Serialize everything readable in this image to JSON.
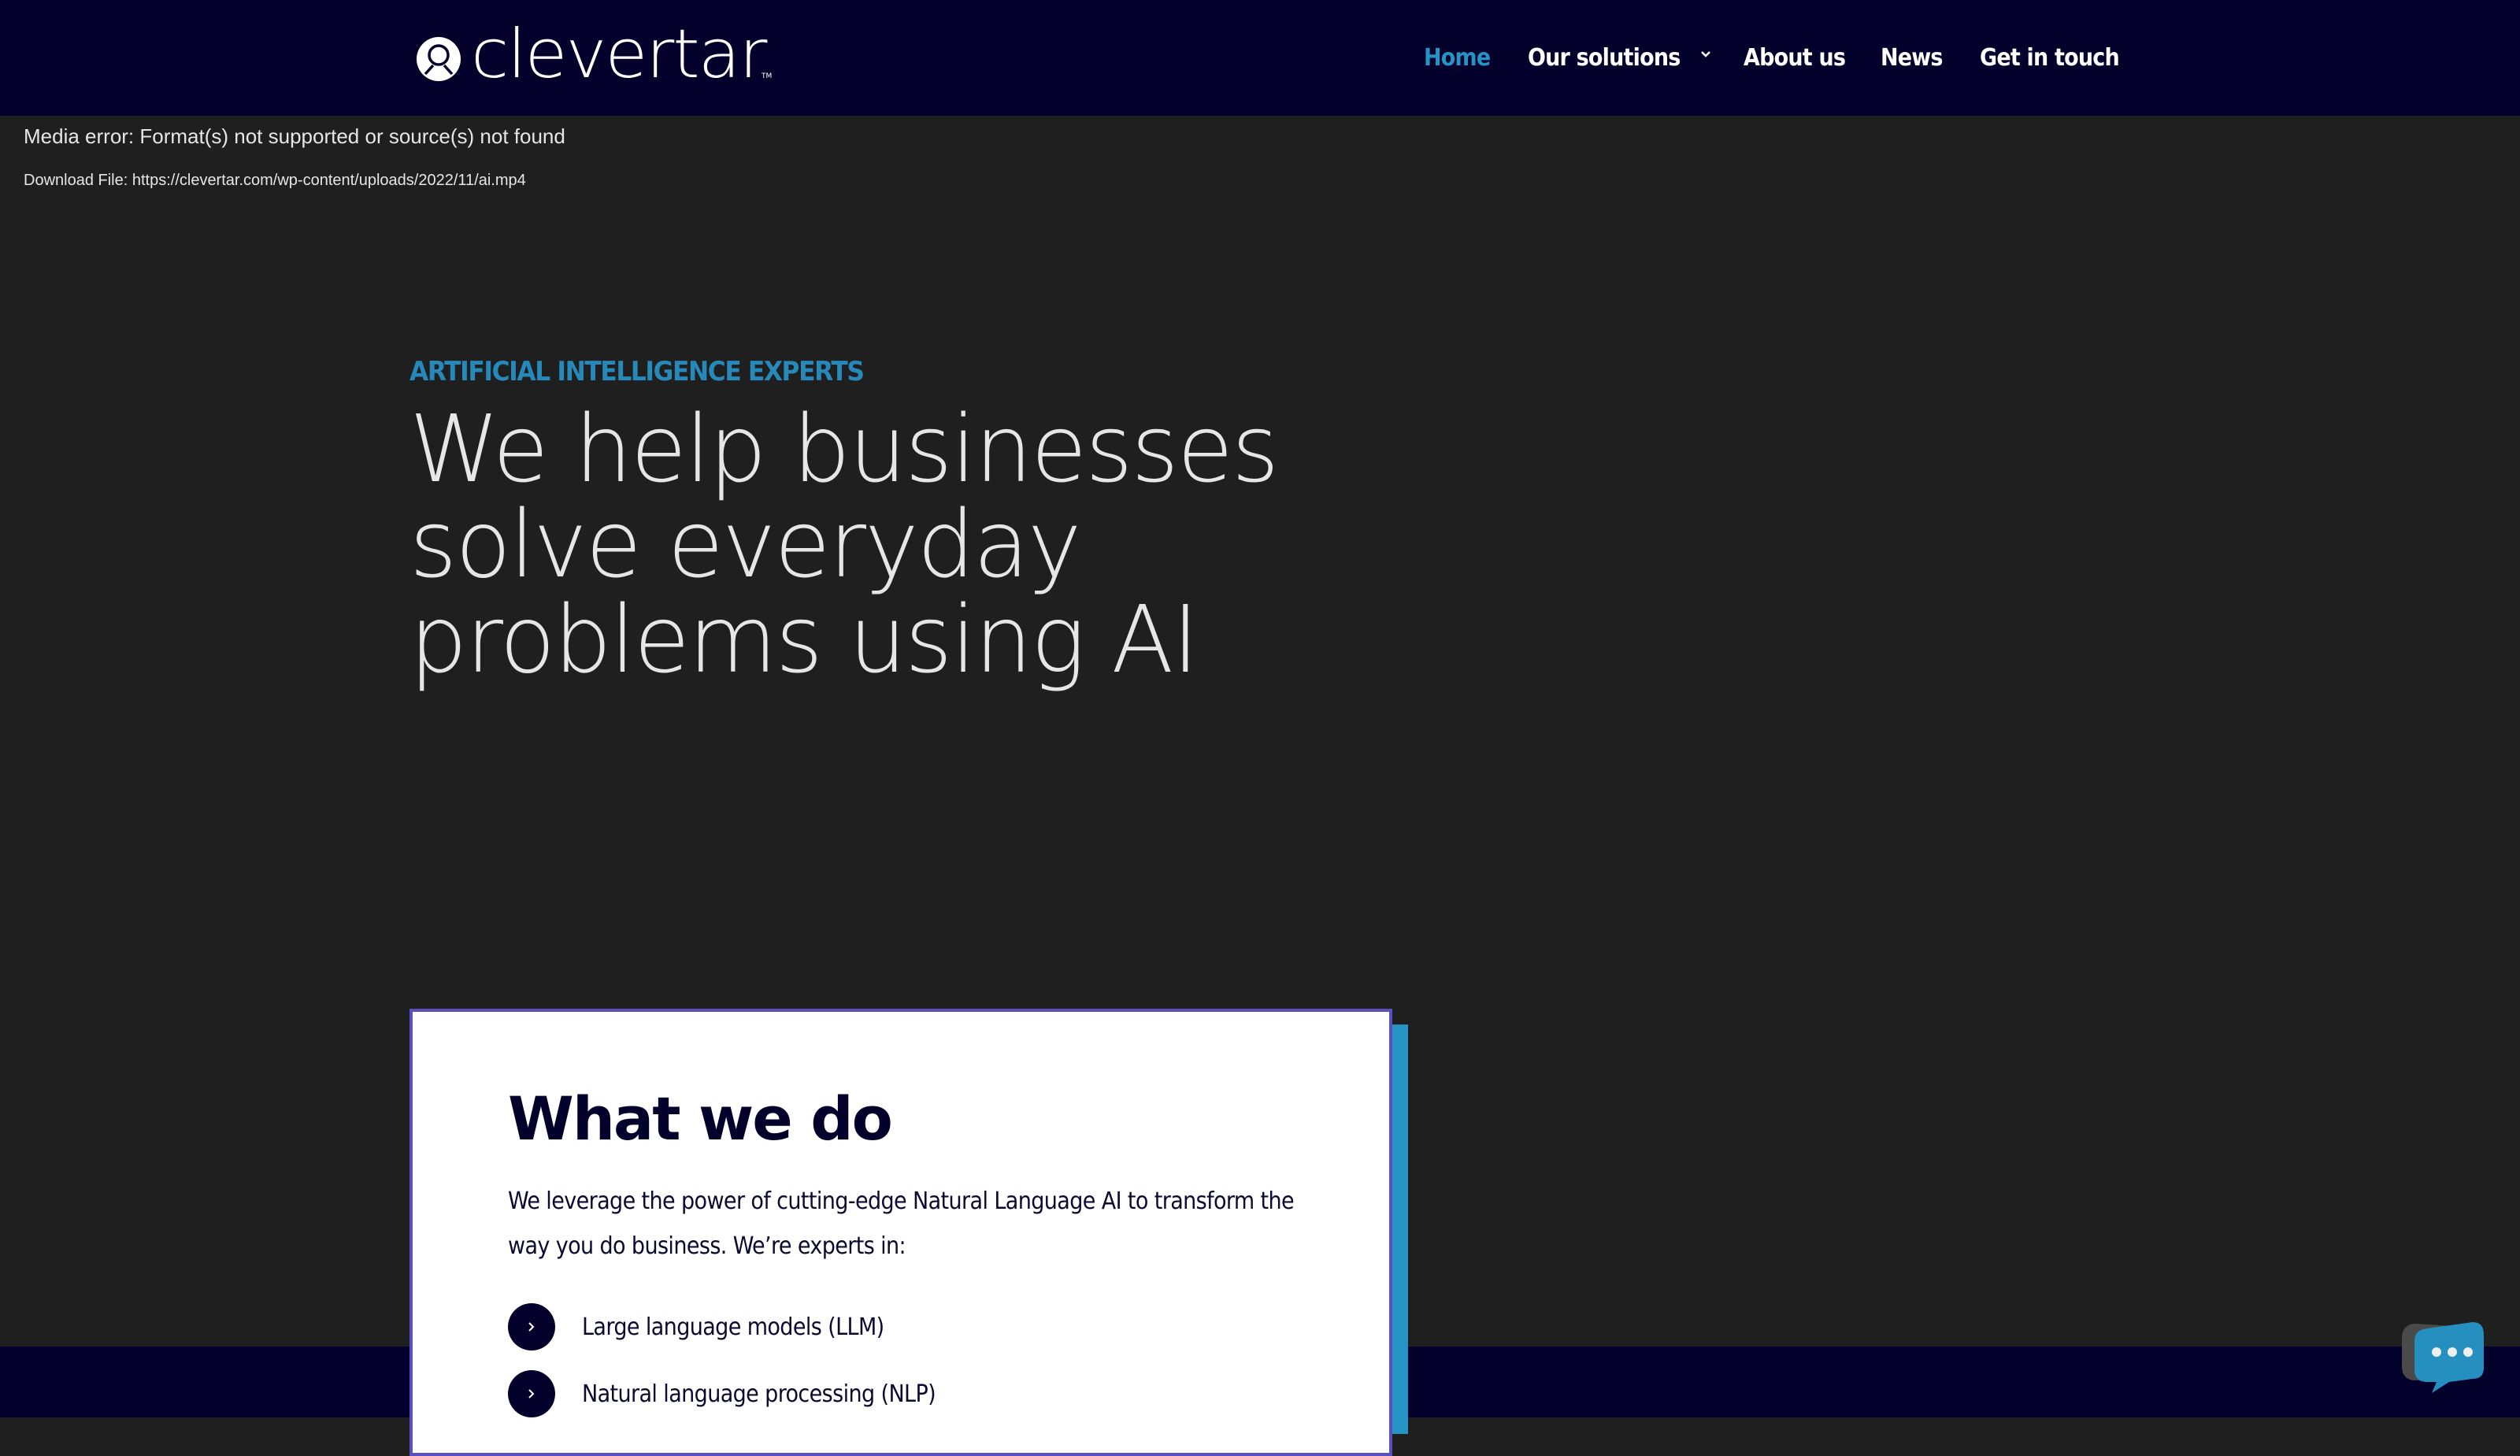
{
  "header": {
    "logo_text": "clevertar",
    "logo_tm": "TM",
    "nav": [
      {
        "label": "Home",
        "active": true
      },
      {
        "label": "Our solutions",
        "has_dropdown": true
      },
      {
        "label": "About us"
      },
      {
        "label": "News"
      },
      {
        "label": "Get in touch"
      }
    ]
  },
  "media": {
    "error": "Media error: Format(s) not supported or source(s) not found",
    "download": "Download File: https://clevertar.com/wp-content/uploads/2022/11/ai.mp4"
  },
  "hero": {
    "eyebrow": "ARTIFICIAL INTELLIGENCE EXPERTS",
    "title_lines": [
      "We help businesses",
      "solve everyday",
      "problems using AI"
    ]
  },
  "what_we_do": {
    "title": "What we do",
    "text": "We leverage the power of cutting-edge Natural Language AI to transform the way you do business. We’re experts in:",
    "items": [
      {
        "icon": "chevron-right-icon",
        "label": "Large language models (LLM)"
      },
      {
        "icon": "chevron-right-icon",
        "label": "Natural language processing (NLP)"
      }
    ]
  },
  "chat_widget": {
    "icon": "chat-bubble-icon"
  },
  "colors": {
    "navy": "#03002b",
    "accent_blue": "#2593c4",
    "card_border": "#5b50c0",
    "background": "#1f1f1f"
  }
}
